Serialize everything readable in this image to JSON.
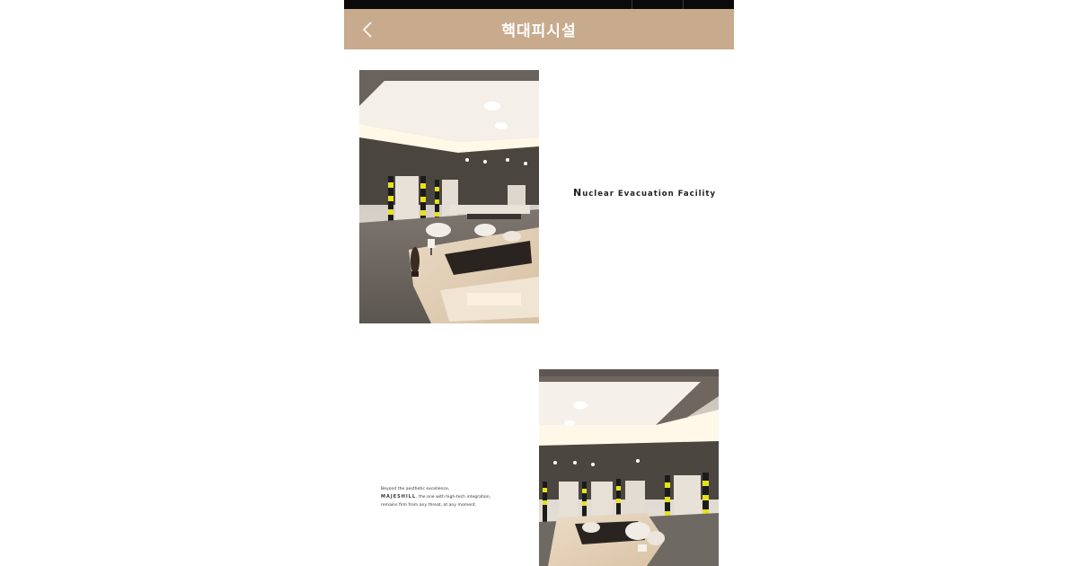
{
  "header": {
    "title": "핵대피시설",
    "back_icon": "chevron-left-icon"
  },
  "colors": {
    "header_bg": "#c8aa8c",
    "status_bar": "#0a0a0a",
    "accent_stripe": "#e6e21a"
  },
  "section1": {
    "facility_first_letter": "N",
    "facility_rest": "uclear Evacuation Facility"
  },
  "section2": {
    "line1": "Beyond the aesthetic excellence,",
    "brand": "MAJESHILL",
    "line2_rest": ", the one with high-tech integration,",
    "line3": "remains firm from any threat, at any moment."
  }
}
